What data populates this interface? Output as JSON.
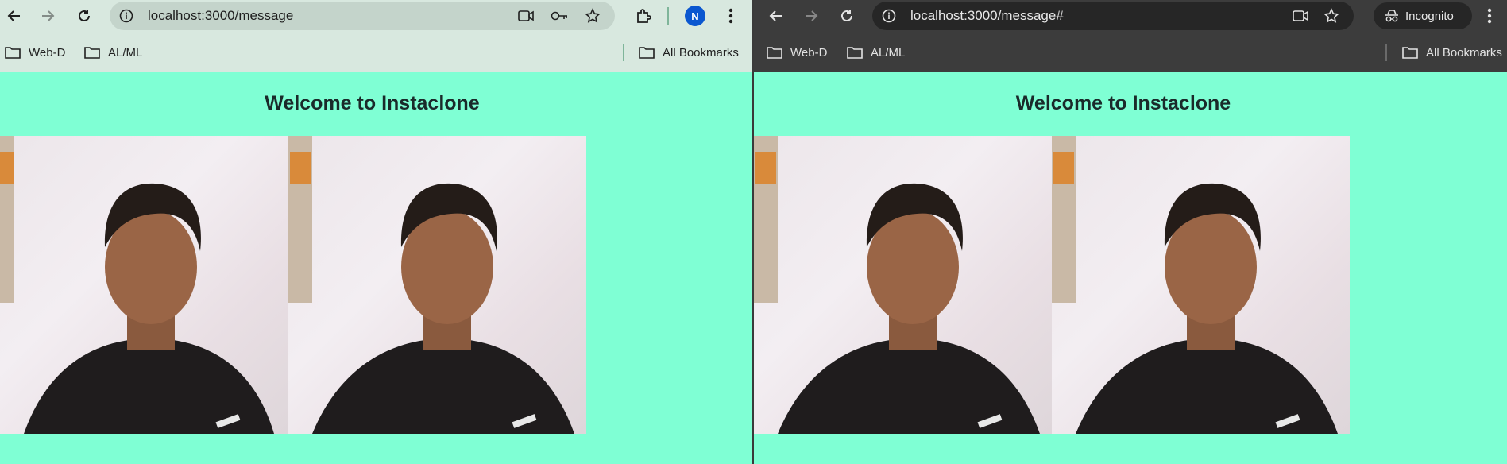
{
  "windows": [
    {
      "mode": "normal",
      "url": "localhost:3000/message",
      "profile_initial": "N",
      "bookmarks": [
        "Web-D",
        "AL/ML"
      ],
      "all_bookmarks": "All Bookmarks",
      "page": {
        "heading": "Welcome to Instaclone",
        "photo_count": 2
      }
    },
    {
      "mode": "incognito",
      "url": "localhost:3000/message#",
      "incognito_label": "Incognito",
      "bookmarks": [
        "Web-D",
        "AL/ML"
      ],
      "all_bookmarks": "All Bookmarks",
      "page": {
        "heading": "Welcome to Instaclone",
        "photo_count": 2
      }
    }
  ],
  "colors": {
    "page_background": "#7fffd4",
    "normal_toolbar": "#d8e8df",
    "incognito_toolbar": "#3c3c3c",
    "profile_avatar": "#0b57d0"
  },
  "icons": [
    "back-arrow-icon",
    "forward-arrow-icon",
    "reload-icon",
    "site-info-icon",
    "camera-icon",
    "key-icon",
    "star-icon",
    "extensions-icon",
    "profile-avatar-icon",
    "menu-dots-icon",
    "folder-icon",
    "incognito-icon"
  ]
}
